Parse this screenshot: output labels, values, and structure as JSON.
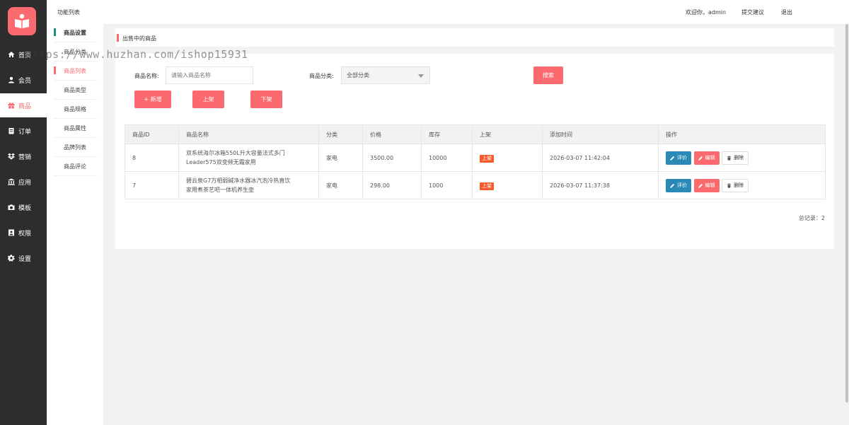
{
  "sidebar": {
    "logo_icon": "book-icon",
    "items": [
      {
        "label": "首页",
        "icon": "home-icon"
      },
      {
        "label": "会员",
        "icon": "user-icon"
      },
      {
        "label": "商品",
        "icon": "gift-icon"
      },
      {
        "label": "订单",
        "icon": "order-icon"
      },
      {
        "label": "营销",
        "icon": "dropbox-icon"
      },
      {
        "label": "应用",
        "icon": "bank-icon"
      },
      {
        "label": "模板",
        "icon": "camera-icon"
      },
      {
        "label": "权限",
        "icon": "id-card-icon"
      },
      {
        "label": "设置",
        "icon": "gear-icon"
      }
    ],
    "active_index": 2,
    "accent": "#fb6a6f",
    "bg": "#2d2d2d"
  },
  "submenu": {
    "title": "功能列表",
    "items": [
      {
        "label": "商品设置"
      },
      {
        "label": "商品分类"
      },
      {
        "label": "商品列表"
      },
      {
        "label": "商品类型"
      },
      {
        "label": "商品规格"
      },
      {
        "label": "商品属性"
      },
      {
        "label": "品牌列表"
      },
      {
        "label": "商品评论"
      }
    ]
  },
  "header": {
    "welcome": "欢迎你，admin",
    "feedback": "提交建议",
    "logout": "退出"
  },
  "breadcrumb": "出售中的商品",
  "search": {
    "name_label": "商品名称:",
    "name_placeholder": "请输入商品名称",
    "category_label": "商品分类:",
    "category_value": "全部分类",
    "search_button": "搜索"
  },
  "actions": {
    "add": "+ 新增",
    "on_shelf": "上架",
    "off_shelf": "下架"
  },
  "table": {
    "headers": [
      "商品ID",
      "商品名称",
      "分类",
      "价格",
      "库存",
      "上架",
      "添加时间",
      "操作"
    ],
    "rows": [
      {
        "id": "8",
        "name_line1": "双系统海尔冰箱550L升大容量法式多门",
        "name_line2": "Leader575双变频无霜家用",
        "category": "家电",
        "price": "3500.00",
        "stock": "10000",
        "status": "上架",
        "added": "2026-03-07 11:42:04"
      },
      {
        "id": "7",
        "name_line1": "碧云泉G7万相弱碱净水器冰汽泡冷热直饮",
        "name_line2": "家用煮茶艺吧一体机养生壶",
        "category": "家电",
        "price": "298.00",
        "stock": "1000",
        "status": "上架",
        "added": "2026-03-07 11:37:38"
      }
    ],
    "row_actions": {
      "rate": "评价",
      "edit": "编辑",
      "delete": "删除"
    }
  },
  "total": "总记录：2",
  "watermark": "https://www.huzhan.com/ishop15931"
}
